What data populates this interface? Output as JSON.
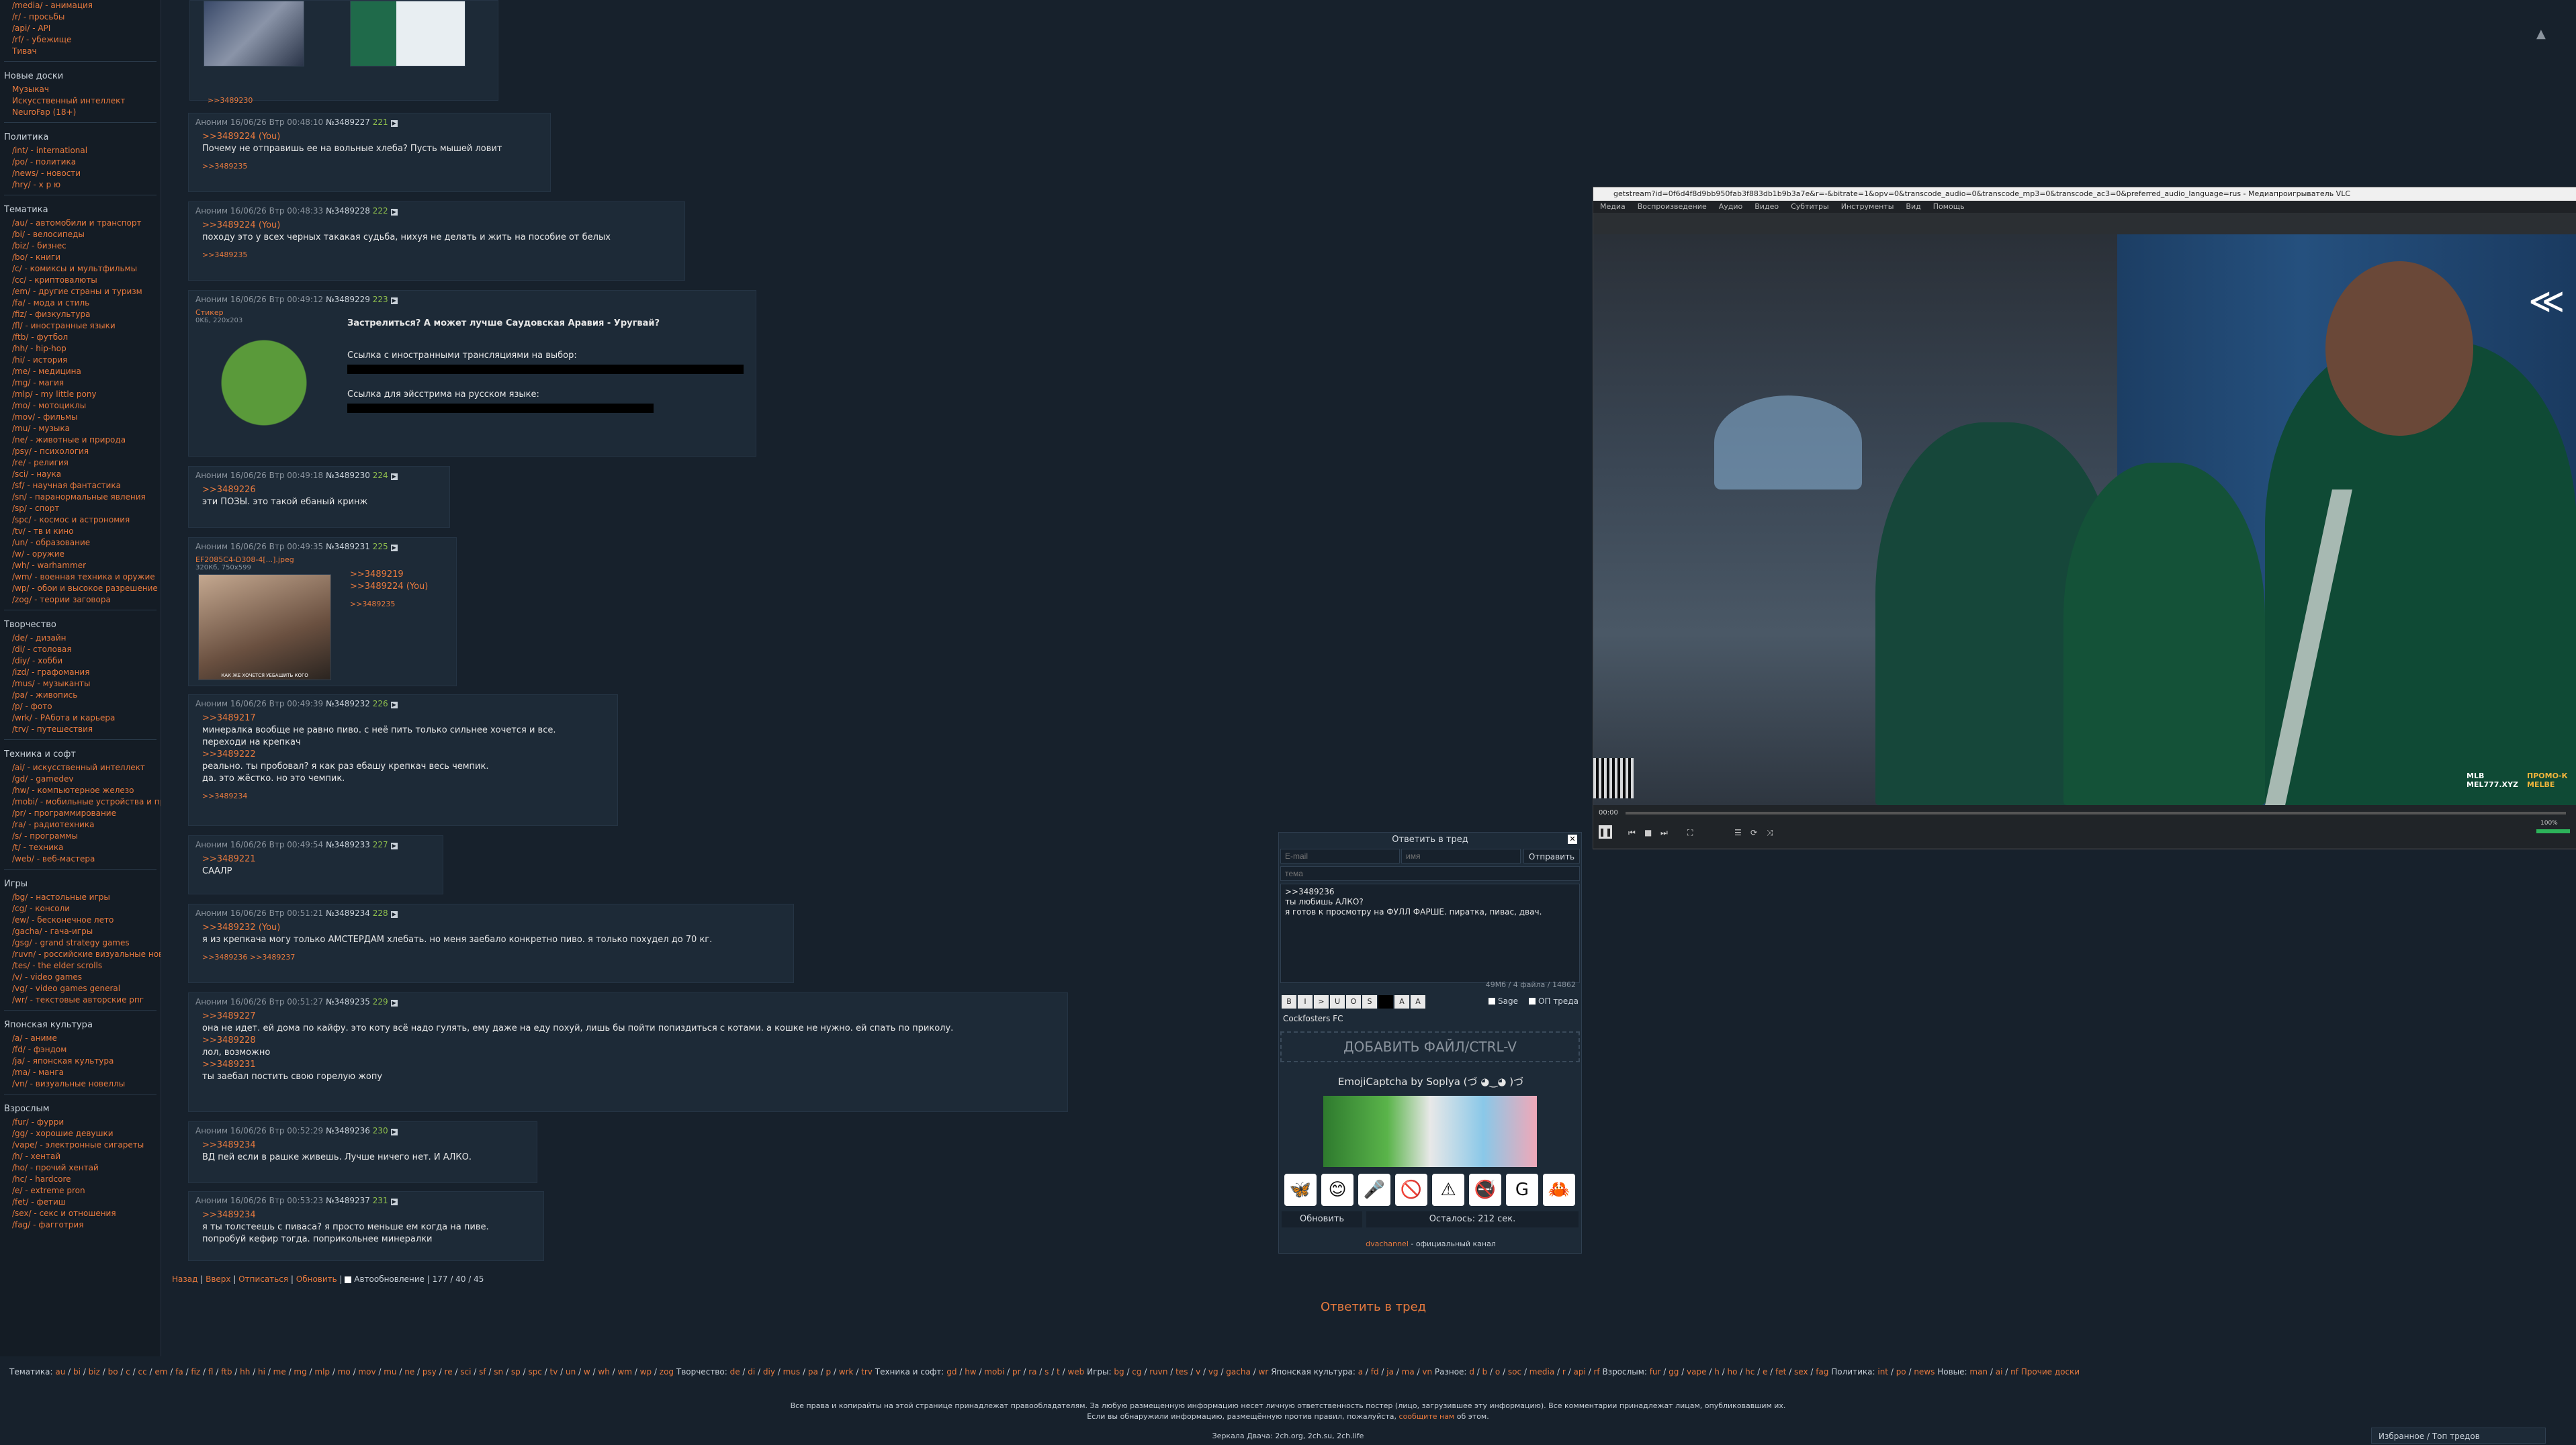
{
  "sidebar": {
    "top_items": [
      "/media/ - анимация",
      "/r/ - просьбы",
      "/api/ - API",
      "/rf/ - убежище",
      "Тивач"
    ],
    "sections": [
      {
        "title": "Новые доски",
        "items": [
          "Музыкач",
          "Искусственный интеллект",
          "NeuroFap (18+)"
        ]
      },
      {
        "title": "Политика",
        "items": [
          "/int/ - international",
          "/po/ - политика",
          "/news/ - новости",
          "/hry/ - х р ю"
        ]
      },
      {
        "title": "Тематика",
        "items": [
          "/au/ - автомобили и транспорт",
          "/bi/ - велосипеды",
          "/biz/ - бизнес",
          "/bo/ - книги",
          "/c/ - комиксы и мультфильмы",
          "/cc/ - криптовалюты",
          "/em/ - другие страны и туризм",
          "/fa/ - мода и стиль",
          "/fiz/ - физкультура",
          "/fl/ - иностранные языки",
          "/ftb/ - футбол",
          "/hh/ - hip-hop",
          "/hi/ - история",
          "/me/ - медицина",
          "/mg/ - магия",
          "/mlp/ - my little pony",
          "/mo/ - мотоциклы",
          "/mov/ - фильмы",
          "/mu/ - музыка",
          "/ne/ - животные и природа",
          "/psy/ - психология",
          "/re/ - религия",
          "/sci/ - наука",
          "/sf/ - научная фантастика",
          "/sn/ - паранормальные явления",
          "/sp/ - спорт",
          "/spc/ - космос и астрономия",
          "/tv/ - тв и кино",
          "/un/ - образование",
          "/w/ - оружие",
          "/wh/ - warhammer",
          "/wm/ - военная техника и оружие",
          "/wp/ - обои и высокое разрешение",
          "/zog/ - теории заговора"
        ]
      },
      {
        "title": "Творчество",
        "items": [
          "/de/ - дизайн",
          "/di/ - столовая",
          "/diy/ - хобби",
          "/izd/ - графомания",
          "/mus/ - музыканты",
          "/pa/ - живопись",
          "/p/ - фото",
          "/wrk/ - РАбота и карьера",
          "/trv/ - путешествия"
        ]
      },
      {
        "title": "Техника и софт",
        "items": [
          "/ai/ - искусственный интеллект",
          "/gd/ - gamedev",
          "/hw/ - компьютерное железо",
          "/mobi/ - мобильные устройства и приложения",
          "/pr/ - программирование",
          "/ra/ - радиотехника",
          "/s/ - программы",
          "/t/ - техника",
          "/web/ - веб-мастера"
        ]
      },
      {
        "title": "Игры",
        "items": [
          "/bg/ - настольные игры",
          "/cg/ - консоли",
          "/ew/ - бесконечное лето",
          "/gacha/ - гача-игры",
          "/gsg/ - grand strategy games",
          "/ruvn/ - российские визуальные новеллы",
          "/tes/ - the elder scrolls",
          "/v/ - video games",
          "/vg/ - video games general",
          "/wr/ - текстовые авторские рпг"
        ]
      },
      {
        "title": "Японская культура",
        "items": [
          "/a/ - аниме",
          "/fd/ - фэндом",
          "/ja/ - японская культура",
          "/ma/ - манга",
          "/vn/ - визуальные новеллы"
        ]
      },
      {
        "title": "Взрослым",
        "items": [
          "/fur/ - фурри",
          "/gg/ - хорошие девушки",
          "/vape/ - электронные сигареты",
          "/h/ - хентай",
          "/ho/ - прочий хентай",
          "/hc/ - hardcore",
          "/e/ - extreme pron",
          "/fet/ - фетиш",
          "/sex/ - секс и отношения",
          "/fag/ - фагготрия"
        ]
      }
    ]
  },
  "posts": [
    {
      "id": "p0",
      "reply": ">>3489230"
    },
    {
      "id": "p1",
      "author": "Аноним",
      "date": "16/06/26 Втр 00:48:10",
      "num": "№3489227",
      "count": "221",
      "lines": [
        {
          "t": "q",
          "v": ">>3489224 (You)"
        },
        {
          "t": "tx",
          "v": "Почему не отправишь ее на вольные хлеба? Пусть мышей ловит"
        }
      ],
      "reply": ">>3489235"
    },
    {
      "id": "p2",
      "author": "Аноним",
      "date": "16/06/26 Втр 00:48:33",
      "num": "№3489228",
      "count": "222",
      "lines": [
        {
          "t": "q",
          "v": ">>3489224 (You)"
        },
        {
          "t": "tx",
          "v": "походу это у всех черных такакая судьба, нихуя не делать и жить на пособие от белых"
        }
      ],
      "reply": ">>3489235"
    },
    {
      "id": "p3",
      "author": "Аноним",
      "date": "16/06/26 Втр 00:49:12",
      "num": "№3489229",
      "count": "223",
      "file": "Стикер",
      "fileinfo": "0KБ, 220x203",
      "lines": [
        {
          "t": "tx",
          "v": "Застрелиться? А может лучше Саудовская Аравия - Уругвай?"
        },
        {
          "t": "tx",
          "v": "Ссылка с иностранными трансляциями на выбор:"
        },
        {
          "t": "tx",
          "v": "Ссылка для эйсстрима на русском языке:"
        }
      ]
    },
    {
      "id": "p4",
      "author": "Аноним",
      "date": "16/06/26 Втр 00:49:18",
      "num": "№3489230",
      "count": "224",
      "lines": [
        {
          "t": "q",
          "v": ">>3489226"
        },
        {
          "t": "tx",
          "v": "эти ПОЗЫ. это такой ебаный кринж"
        }
      ]
    },
    {
      "id": "p5",
      "author": "Аноним",
      "date": "16/06/26 Втр 00:49:35",
      "num": "№3489231",
      "count": "225",
      "file": "EF2085C4-D308-4[...].jpeg",
      "fileinfo": "320Кб, 750x599",
      "caption": "КАК ЖЕ ХОЧЕТСЯ УЕБАШИТЬ КОГО",
      "lines": [
        {
          "t": "q",
          "v": ">>3489219"
        },
        {
          "t": "q",
          "v": ">>3489224 (You)"
        }
      ],
      "reply": ">>3489235"
    },
    {
      "id": "p6",
      "author": "Аноним",
      "date": "16/06/26 Втр 00:49:39",
      "num": "№3489232",
      "count": "226",
      "lines": [
        {
          "t": "q",
          "v": ">>3489217"
        },
        {
          "t": "tx",
          "v": "минералка вообще не равно пиво. с неё пить только сильнее хочется и все."
        },
        {
          "t": "tx",
          "v": "переходи на крепкач"
        },
        {
          "t": "q",
          "v": ">>3489222"
        },
        {
          "t": "tx",
          "v": "реально. ты пробовал? я как раз ебашу крепкач весь чемпик."
        },
        {
          "t": "tx",
          "v": "да. это жёстко. но это чемпик."
        }
      ],
      "reply": ">>3489234"
    },
    {
      "id": "p7",
      "author": "Аноним",
      "date": "16/06/26 Втр 00:49:54",
      "num": "№3489233",
      "count": "227",
      "lines": [
        {
          "t": "q",
          "v": ">>3489221"
        },
        {
          "t": "tx",
          "v": "СААЛР"
        }
      ]
    },
    {
      "id": "p8",
      "author": "Аноним",
      "date": "16/06/26 Втр 00:51:21",
      "num": "№3489234",
      "count": "228",
      "lines": [
        {
          "t": "q",
          "v": ">>3489232 (You)"
        },
        {
          "t": "tx",
          "v": "я из крепкача могу только АМСТЕРДАМ хлебать. но меня заебало конкретно пиво. я только похудел до 70 кг."
        }
      ],
      "reply": ">>3489236 >>3489237"
    },
    {
      "id": "p9",
      "author": "Аноним",
      "date": "16/06/26 Втр 00:51:27",
      "num": "№3489235",
      "count": "229",
      "lines": [
        {
          "t": "q",
          "v": ">>3489227"
        },
        {
          "t": "tx",
          "v": "она не идет. ей дома по кайфу. это коту всё надо гулять, ему даже на еду похуй, лишь бы пойти попиздиться с котами. а кошке не нужно. ей спать по приколу."
        },
        {
          "t": "q",
          "v": ">>3489228"
        },
        {
          "t": "tx",
          "v": "лол, возможно"
        },
        {
          "t": "q",
          "v": ">>3489231"
        },
        {
          "t": "tx",
          "v": "ты заебал постить свою горелую жопу"
        }
      ]
    },
    {
      "id": "p10",
      "author": "Аноним",
      "date": "16/06/26 Втр 00:52:29",
      "num": "№3489236",
      "count": "230",
      "lines": [
        {
          "t": "q",
          "v": ">>3489234"
        },
        {
          "t": "tx",
          "v": "ВД пей если в рашке живешь. Лучше ничего нет. И АЛКО."
        }
      ]
    },
    {
      "id": "p11",
      "author": "Аноним",
      "date": "16/06/26 Втр 00:53:23",
      "num": "№3489237",
      "count": "231",
      "lines": [
        {
          "t": "q",
          "v": ">>3489234"
        },
        {
          "t": "tx",
          "v": "я ты толстеешь с пиваса? я просто меньше ем когда на пиве."
        },
        {
          "t": "tx",
          "v": "попробуй кефир тогда. поприкольнее минералки"
        }
      ]
    }
  ],
  "thread_nav": {
    "back": "Назад",
    "top": "Вверх",
    "unsubscribe": "Отписаться",
    "refresh": "Обновить",
    "autorefresh": "Автообновление",
    "stats": "177 / 40 / 45",
    "reply_link": "Ответить в тред"
  },
  "vlc": {
    "title": "getstream?id=0f6d4f8d9bb950fab3f883db1b9b3a7e&r=-&bitrate=1&opv=0&transcode_audio=0&transcode_mp3=0&transcode_ac3=0&preferred_audio_language=rus - Медиапроигрыватель VLC",
    "menu": [
      "Медиа",
      "Воспроизведение",
      "Аудио",
      "Видео",
      "Субтитры",
      "Инструменты",
      "Вид",
      "Помощь"
    ],
    "time": "00:00",
    "volume": "100%",
    "overlay_logo": "MLB MEL777.XYZ",
    "overlay_promo": "ПРОМО-К MELBE"
  },
  "reply_form": {
    "title": "Ответить в тред",
    "email_placeholder": "E-mail",
    "name_placeholder": "имя",
    "submit": "Отправить",
    "subject_placeholder": "тема",
    "message_lines": [
      ">>3489236",
      "ты любишь АЛКО?",
      "я готов к просмотру на ФУЛЛ ФАРШЕ. пиратка, пивас, двач."
    ],
    "counter": "49Мб / 4 файла / 14862",
    "sage": "Sage",
    "op": "ОП треда",
    "flag_name": "Cockfosters FC",
    "add_file": "ДОБАВИТЬ ФАЙЛ/CTRL-V",
    "captcha_title": "EmojiCaptcha by Soplya (づ ◕‿◕ )づ",
    "captcha_symbols": [
      "🦋",
      "😊",
      "🎤",
      "🚫",
      "⚠",
      "🚭",
      "G",
      "🦀"
    ],
    "refresh": "Обновить",
    "remaining": "Осталось: 212 сек.",
    "channel_link": "dvachannel",
    "channel_text": " - официальный канал"
  },
  "footer": {
    "groups": [
      {
        "label": "Тематика:",
        "links": [
          "au",
          "bi",
          "biz",
          "bo",
          "c",
          "cc",
          "em",
          "fa",
          "fiz",
          "fl",
          "ftb",
          "hh",
          "hi",
          "me",
          "mg",
          "mlp",
          "mo",
          "mov",
          "mu",
          "ne",
          "psy",
          "re",
          "sci",
          "sf",
          "sn",
          "sp",
          "spc",
          "tv",
          "un",
          "w",
          "wh",
          "wm",
          "wp",
          "zog"
        ]
      },
      {
        "label": "Творчество:",
        "links": [
          "de",
          "di",
          "diy",
          "mus",
          "pa",
          "p",
          "wrk",
          "trv"
        ]
      },
      {
        "label": "Техника и софт:",
        "links": [
          "gd",
          "hw",
          "mobi",
          "pr",
          "ra",
          "s",
          "t",
          "web"
        ]
      },
      {
        "label": "Игры:",
        "links": [
          "bg",
          "cg",
          "ruvn",
          "tes",
          "v",
          "vg",
          "gacha",
          "wr"
        ]
      },
      {
        "label": "Японская культура:",
        "links": [
          "a",
          "fd",
          "ja",
          "ma",
          "vn"
        ]
      },
      {
        "label": "Разное:",
        "links": [
          "d",
          "b",
          "o",
          "soc",
          "media",
          "r",
          "api",
          "rf"
        ]
      },
      {
        "label": "Взрослым:",
        "links": [
          "fur",
          "gg",
          "vape",
          "h",
          "ho",
          "hc",
          "e",
          "fet",
          "sex",
          "fag"
        ]
      },
      {
        "label": "Политика:",
        "links": [
          "int",
          "po",
          "news"
        ]
      },
      {
        "label": "Новые:",
        "links": [
          "man",
          "ai",
          "nf"
        ]
      }
    ],
    "new_boards": "Прочие доски",
    "copyright": "Все права и копирайты на этой странице принадлежат правообладателям. За любую размещенную информацию несет личную ответственность постер (лицо, загрузившее эту информацию). Все комментарии принадлежат лицам, опубликовавшим их.",
    "copyright2": "Если вы обнаружили информацию, размещённую против правил, пожалуйста,",
    "copyright_link": "сообщите нам",
    "copyright3": "об этом.",
    "mirrors": "Зеркала Двача: 2ch.org, 2ch.su, 2ch.life",
    "favorites": "Избранное / Топ тредов"
  }
}
